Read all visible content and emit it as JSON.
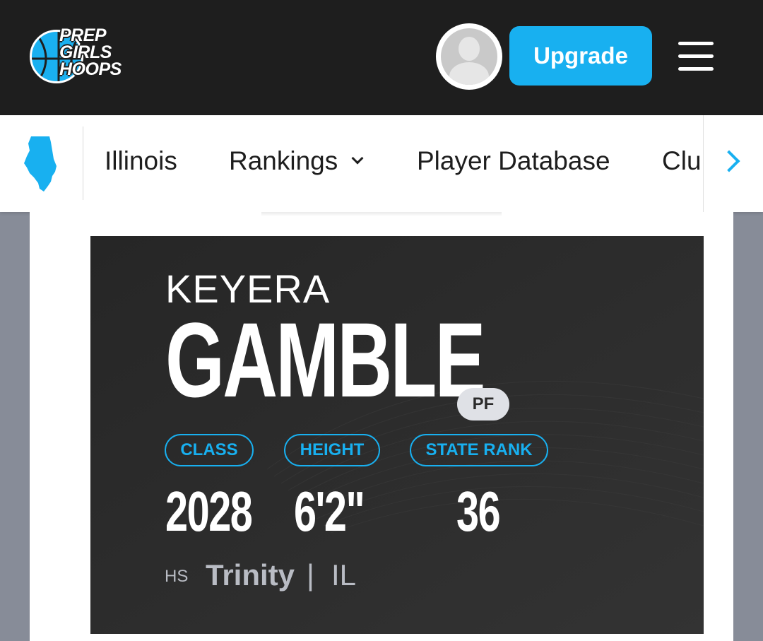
{
  "header": {
    "logo": {
      "line1": "PREP",
      "line2": "GIRLS",
      "line3": "HOOPS"
    },
    "upgrade_label": "Upgrade",
    "avatar_icon": "user-avatar-placeholder",
    "menu_icon": "hamburger-menu-icon"
  },
  "nav": {
    "state_icon": "illinois-state-icon",
    "items": [
      {
        "label": "Illinois"
      },
      {
        "label": "Rankings",
        "has_dropdown": true
      },
      {
        "label": "Player Database"
      },
      {
        "label": "Clu"
      }
    ],
    "scroll_icon": "chevron-right-icon"
  },
  "player": {
    "first_name": "KEYERA",
    "last_name": "GAMBLE",
    "position": "PF",
    "stats": [
      {
        "label": "CLASS",
        "value": "2028"
      },
      {
        "label": "HEIGHT",
        "value": "6'2\""
      },
      {
        "label": "STATE RANK",
        "value": "36"
      }
    ],
    "hs_label": "HS",
    "school": "Trinity",
    "separator": "|",
    "state": "IL"
  },
  "colors": {
    "accent": "#18b0f0",
    "header_bg": "#1e1e1e",
    "hero_bg": "#2b2b2b",
    "page_bg": "#878c98"
  }
}
